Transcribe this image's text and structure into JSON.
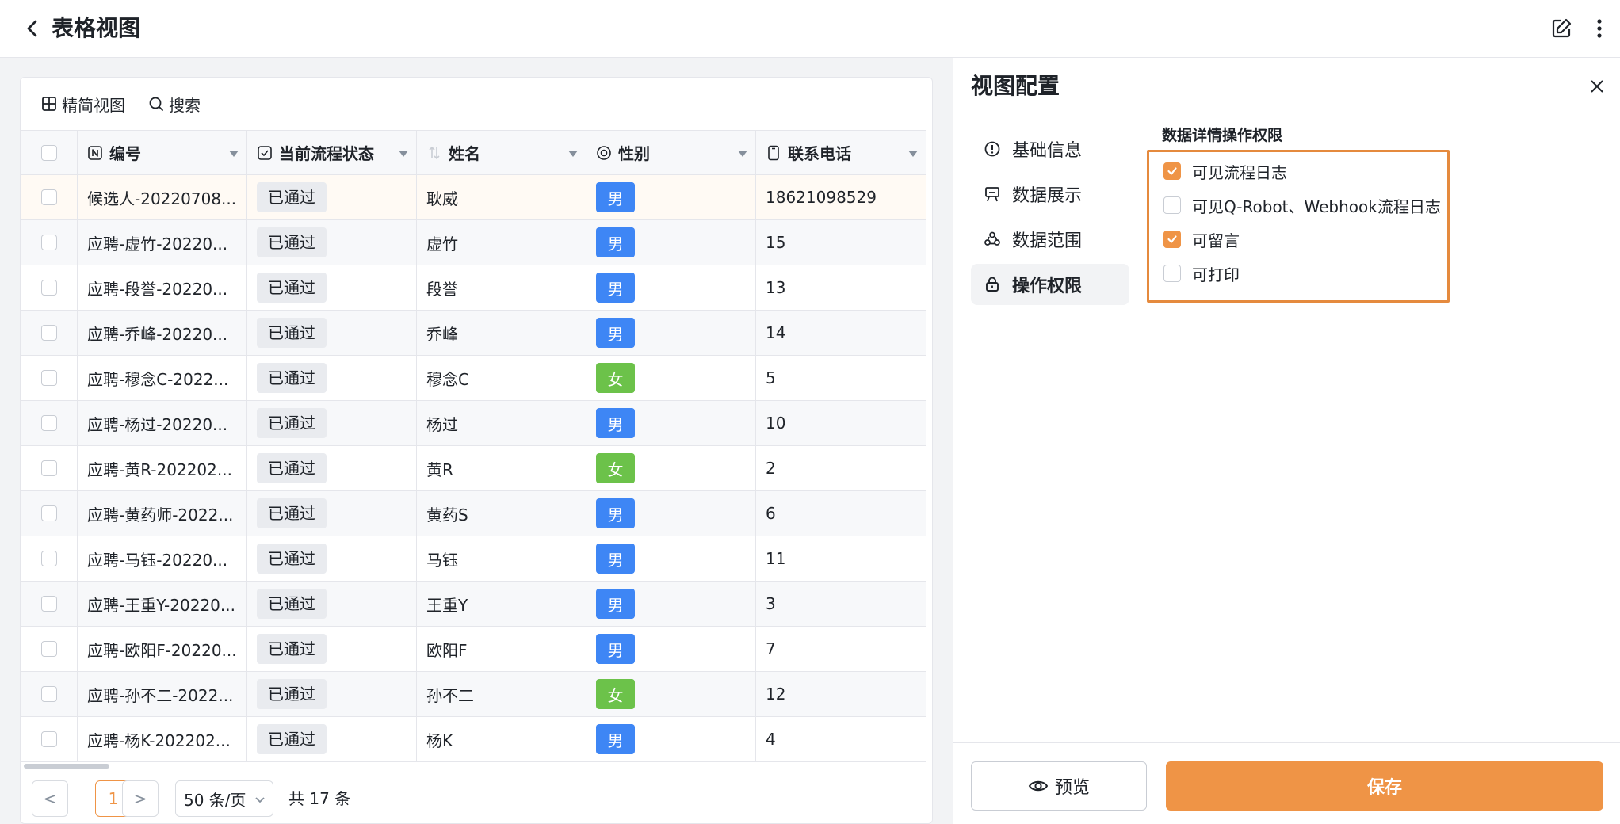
{
  "header": {
    "title": "表格视图"
  },
  "toolbar": {
    "compact_view": "精简视图",
    "search": "搜索"
  },
  "table": {
    "columns": [
      "编号",
      "当前流程状态",
      "姓名",
      "性别",
      "联系电话"
    ],
    "rows": [
      {
        "id": "候选人-20220708...",
        "status": "已通过",
        "name": "耿威",
        "gender": "男",
        "phone": "18621098529"
      },
      {
        "id": "应聘-虚竹-20220...",
        "status": "已通过",
        "name": "虚竹",
        "gender": "男",
        "phone": "15"
      },
      {
        "id": "应聘-段誉-20220...",
        "status": "已通过",
        "name": "段誉",
        "gender": "男",
        "phone": "13"
      },
      {
        "id": "应聘-乔峰-20220...",
        "status": "已通过",
        "name": "乔峰",
        "gender": "男",
        "phone": "14"
      },
      {
        "id": "应聘-穆念C-2022...",
        "status": "已通过",
        "name": "穆念C",
        "gender": "女",
        "phone": "5"
      },
      {
        "id": "应聘-杨过-20220...",
        "status": "已通过",
        "name": "杨过",
        "gender": "男",
        "phone": "10"
      },
      {
        "id": "应聘-黄R-202202...",
        "status": "已通过",
        "name": "黄R",
        "gender": "女",
        "phone": "2"
      },
      {
        "id": "应聘-黄药师-2022...",
        "status": "已通过",
        "name": "黄药S",
        "gender": "男",
        "phone": "6"
      },
      {
        "id": "应聘-马钰-20220...",
        "status": "已通过",
        "name": "马钰",
        "gender": "男",
        "phone": "11"
      },
      {
        "id": "应聘-王重Y-20220...",
        "status": "已通过",
        "name": "王重Y",
        "gender": "男",
        "phone": "3"
      },
      {
        "id": "应聘-欧阳F-20220...",
        "status": "已通过",
        "name": "欧阳F",
        "gender": "男",
        "phone": "7"
      },
      {
        "id": "应聘-孙不二-2022...",
        "status": "已通过",
        "name": "孙不二",
        "gender": "女",
        "phone": "12"
      },
      {
        "id": "应聘-杨K-202202...",
        "status": "已通过",
        "name": "杨K",
        "gender": "男",
        "phone": "4"
      }
    ]
  },
  "pagination": {
    "prev": "<",
    "current": "1",
    "next": ">",
    "page_size": "50 条/页",
    "total": "共 17 条"
  },
  "panel": {
    "title": "视图配置",
    "nav": [
      {
        "label": "基础信息",
        "icon": "info-circle-icon"
      },
      {
        "label": "数据展示",
        "icon": "display-board-icon"
      },
      {
        "label": "数据范围",
        "icon": "scope-icon"
      },
      {
        "label": "操作权限",
        "icon": "lock-icon"
      }
    ],
    "active_nav": "操作权限",
    "section_title": "数据详情操作权限",
    "permissions": [
      {
        "label": "可见流程日志",
        "checked": true
      },
      {
        "label": "可见Q-Robot、Webhook流程日志",
        "checked": false
      },
      {
        "label": "可留言",
        "checked": true
      },
      {
        "label": "可打印",
        "checked": false
      }
    ],
    "preview_label": "预览",
    "save_label": "保存"
  },
  "colors": {
    "accent": "#ef9446",
    "male_tag": "#3e86f5",
    "female_tag": "#6cc24a",
    "highlight_border": "#e58a3e"
  }
}
